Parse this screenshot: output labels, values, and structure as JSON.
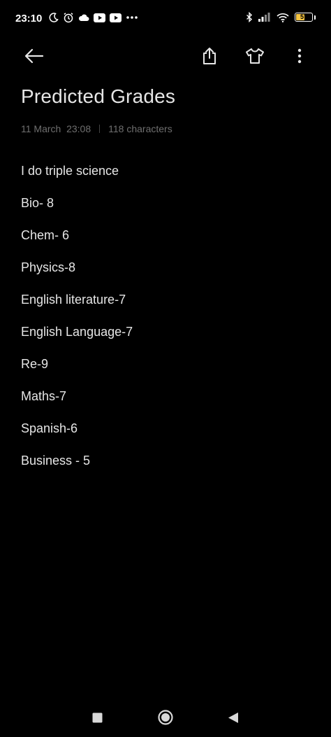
{
  "status_bar": {
    "time": "23:10",
    "battery_level": "57",
    "battery_color": "#f5c542",
    "left_icons": [
      "moon-icon",
      "alarm-icon",
      "cloud-icon",
      "youtube-icon",
      "youtube-icon",
      "more-dots-icon"
    ],
    "right_icons": [
      "bluetooth-icon",
      "signal-icon",
      "wifi-icon",
      "battery-icon"
    ]
  },
  "toolbar": {
    "icons": [
      "back-arrow-icon",
      "share-icon",
      "tshirt-theme-icon",
      "more-vertical-icon"
    ]
  },
  "note": {
    "title": "Predicted Grades",
    "date": "11 March  23:08",
    "char_count": "118 characters",
    "lines": [
      "I do triple science",
      "Bio- 8",
      "Chem- 6",
      "Physics-8",
      "English literature-7",
      "English Language-7",
      "Re-9",
      "Maths-7",
      "Spanish-6",
      "Business - 5"
    ]
  },
  "nav_bar": {
    "icons": [
      "recents-square-icon",
      "home-circle-icon",
      "back-triangle-icon"
    ]
  },
  "colors": {
    "background": "#000000",
    "text": "#e6e6e6",
    "meta_text": "#6f6f6f"
  }
}
